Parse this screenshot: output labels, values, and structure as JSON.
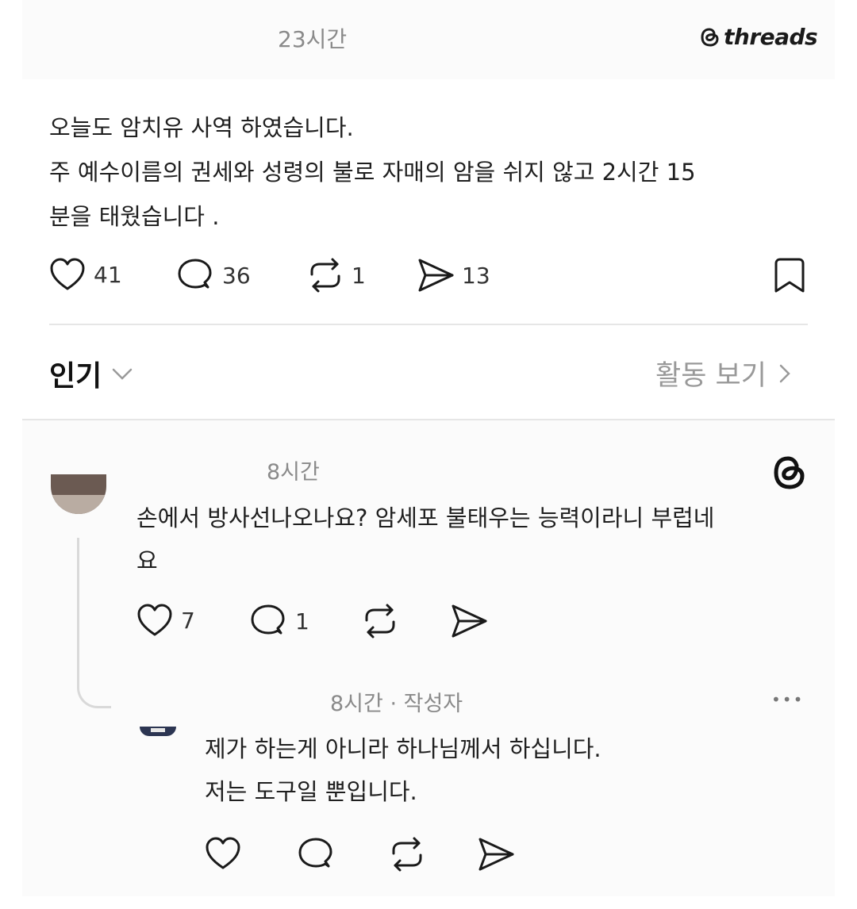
{
  "post": {
    "time": "23시간",
    "brand": "threads",
    "lines": [
      "오늘도 암치유 사역 하였습니다.",
      "주 예수이름의 권세와 성령의 불로  자매의 암을 쉬지 않고 2시간 15",
      "분을 태웠습니다 ."
    ],
    "stats": {
      "likes": "41",
      "comments": "36",
      "reposts": "1",
      "shares": "13"
    }
  },
  "sort": {
    "label": "인기",
    "activity_label": "활동 보기"
  },
  "reply1": {
    "time": "8시간",
    "lines": [
      "손에서 방사선나오나요? 암세포 불태우는 능력이라니 부럽네",
      "요"
    ],
    "stats": {
      "likes": "7",
      "comments": "1"
    }
  },
  "reply2": {
    "time": "8시간 · 작성자",
    "more": "•••",
    "lines": [
      "제가 하는게 아니라 하나님께서 하십니다.",
      "저는 도구일 뿐입니다."
    ]
  },
  "colors": {
    "text": "#1a1a1a",
    "muted": "#8a8a8a",
    "divider": "#e6e6e6"
  }
}
